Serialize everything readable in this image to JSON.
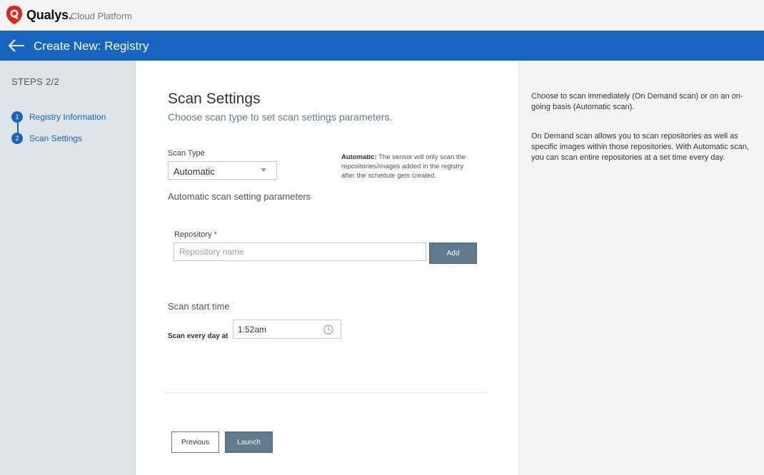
{
  "topbar": {
    "logo_icon": "qualys-shield-icon",
    "brand": "Qualys",
    "brand_dot": ".",
    "product": "Cloud Platform",
    "colors": {
      "logo": "#e2231a"
    }
  },
  "header": {
    "back_icon": "arrow-left-icon",
    "title": "Create New: Registry",
    "color": "#1565c0"
  },
  "sidebar": {
    "steps_label": "STEPS 2/2",
    "steps": [
      {
        "num": "1",
        "label": "Registry Information"
      },
      {
        "num": "2",
        "label": "Scan Settings"
      }
    ]
  },
  "main": {
    "title": "Scan Settings",
    "subtitle": "Choose scan type to set scan settings parameters.",
    "scan_type": {
      "label": "Scan Type",
      "value": "Automatic"
    },
    "auto_note": {
      "lead": "Automatic:",
      "text": " The sensor will only scan the repositories/images added in the registry after the schedule gets created."
    },
    "section_label": "Automatic scan setting parameters",
    "repository": {
      "label": "Repository",
      "required_mark": "*",
      "placeholder": "Repository name",
      "value": "",
      "add_label": "Add"
    },
    "schedule": {
      "label": "Scan start time",
      "every_label": "Scan every day at",
      "time": "1:52am",
      "clock_icon": "clock-icon"
    },
    "buttons": {
      "previous": "Previous",
      "launch": "Launch"
    }
  },
  "help": {
    "p1": "Choose to scan immediately (On Demand scan) or on an on-going basis (Automatic scan).",
    "p2": "On Demand scan allows you to scan repositories as well as specific images within those repositories. With Automatic scan, you can scan entire repositories at a set time every day."
  }
}
